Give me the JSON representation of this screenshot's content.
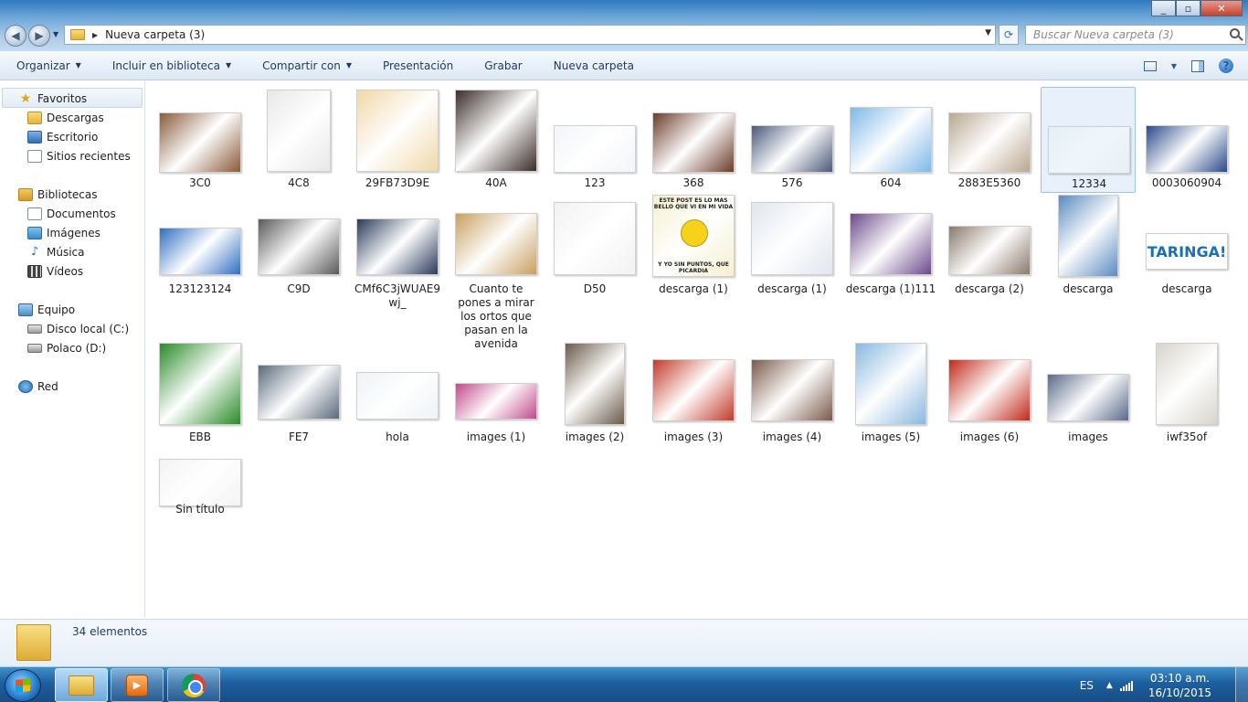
{
  "window": {
    "path_label": "Nueva carpeta (3)",
    "search_placeholder": "Buscar Nueva carpeta (3)"
  },
  "toolbar": {
    "organize": "Organizar",
    "include_library": "Incluir en biblioteca",
    "share_with": "Compartir con",
    "slideshow": "Presentación",
    "burn": "Grabar",
    "new_folder": "Nueva carpeta"
  },
  "sidebar": {
    "favorites": "Favoritos",
    "downloads": "Descargas",
    "desktop": "Escritorio",
    "recent": "Sitios recientes",
    "libraries": "Bibliotecas",
    "documents": "Documentos",
    "images": "Imágenes",
    "music": "Música",
    "videos": "Vídeos",
    "computer": "Equipo",
    "local_disk": "Disco local (C:)",
    "drive_d": "Polaco (D:)",
    "network": "Red"
  },
  "files": [
    {
      "name": "3C0",
      "color": "#8a5a3a"
    },
    {
      "name": "4C8",
      "color": "#e8e8e8"
    },
    {
      "name": "29FB73D9E",
      "color": "#f0d8a8"
    },
    {
      "name": "40A",
      "color": "#3a2e2a"
    },
    {
      "name": "123",
      "color": "#f2f5fa"
    },
    {
      "name": "368",
      "color": "#6b3b2a"
    },
    {
      "name": "576",
      "color": "#4a5a7a"
    },
    {
      "name": "604",
      "color": "#7fb8e8"
    },
    {
      "name": "2883E5360",
      "color": "#b8a890"
    },
    {
      "name": "12334",
      "color": "#e6f0f4"
    },
    {
      "name": "0003060904",
      "color": "#2a4a8a"
    },
    {
      "name": "123123124",
      "color": "#2f6fc0"
    },
    {
      "name": "C9D",
      "color": "#5a5a5a"
    },
    {
      "name": "CMf6C3jWUAE9wj_",
      "color": "#2a3a5a"
    },
    {
      "name": "Cuanto te pones a mirar los ortos que pasan en la avenida",
      "color": "#c8a060"
    },
    {
      "name": "D50",
      "color": "#f2f2f2"
    },
    {
      "name": "descarga (1)",
      "color": "#f6f0d0",
      "caption_top": "ESTE POST ES LO MAS BELLO QUE VI EN MI VIDA",
      "caption_bottom": "Y YO SIN PUNTOS, QUE PICARDIA"
    },
    {
      "name": "descarga (1)",
      "color": "#dfe6ee"
    },
    {
      "name": "descarga (1)111",
      "color": "#6a4a8a"
    },
    {
      "name": "descarga (2)",
      "color": "#8a7a6a"
    },
    {
      "name": "descarga",
      "color": "#5a8ac0"
    },
    {
      "name": "descarga",
      "color": "#ffffff",
      "logo": "TARINGA!"
    },
    {
      "name": "EBB",
      "color": "#2a8a2a"
    },
    {
      "name": "FE7",
      "color": "#5a6a7a"
    },
    {
      "name": "hola",
      "color": "#eef3f6"
    },
    {
      "name": "images (1)",
      "color": "#c04a8a"
    },
    {
      "name": "images (2)",
      "color": "#6a5a4a"
    },
    {
      "name": "images (3)",
      "color": "#c03a2a"
    },
    {
      "name": "images (4)",
      "color": "#7a5a4a"
    },
    {
      "name": "images (5)",
      "color": "#8ab8e0"
    },
    {
      "name": "images (6)",
      "color": "#c02a1a"
    },
    {
      "name": "images",
      "color": "#5a6a8a"
    },
    {
      "name": "iwf35of",
      "color": "#d8d4cc"
    },
    {
      "name": "Sin título",
      "color": "#f4f4f4"
    }
  ],
  "status": {
    "count": "34 elementos"
  },
  "taskbar": {
    "lang": "ES",
    "time": "03:10 a.m.",
    "date": "16/10/2015"
  }
}
